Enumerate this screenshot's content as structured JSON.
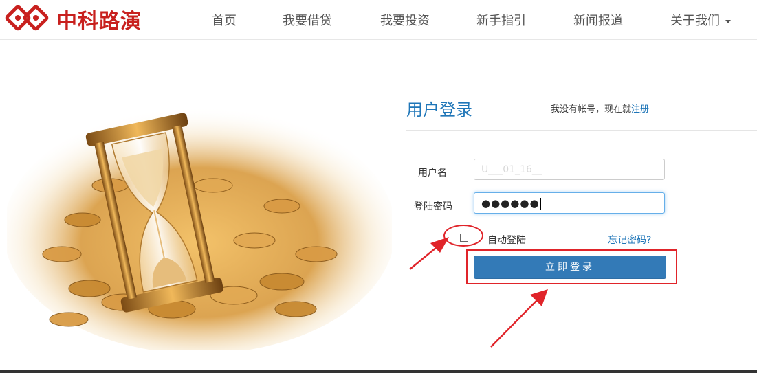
{
  "brand": {
    "name": "中科路演",
    "logo_color": "#c8201e"
  },
  "nav": {
    "items": [
      {
        "label": "首页"
      },
      {
        "label": "我要借贷"
      },
      {
        "label": "我要投资"
      },
      {
        "label": "新手指引"
      },
      {
        "label": "新闻报道"
      },
      {
        "label": "关于我们",
        "has_dropdown": true
      }
    ]
  },
  "login": {
    "title": "用户登录",
    "register_prompt": "我没有帐号，现在就",
    "register_link": "注册",
    "username_label": "用户名",
    "username_value": "U___01_16__",
    "password_label": "登陆密码",
    "password_value": "●●●●●●",
    "remember_label": "自动登陆",
    "remember_checked": false,
    "forgot_link": "忘记密码?",
    "submit_label": "立即登录"
  },
  "colors": {
    "accent": "#1f76b8",
    "button": "#337ab7",
    "annotation": "#e0242a"
  },
  "icons": {
    "logo": "interlocking-rings-logo-icon",
    "hero": "hourglass-coins-illustration",
    "dropdown": "caret-down-icon"
  }
}
